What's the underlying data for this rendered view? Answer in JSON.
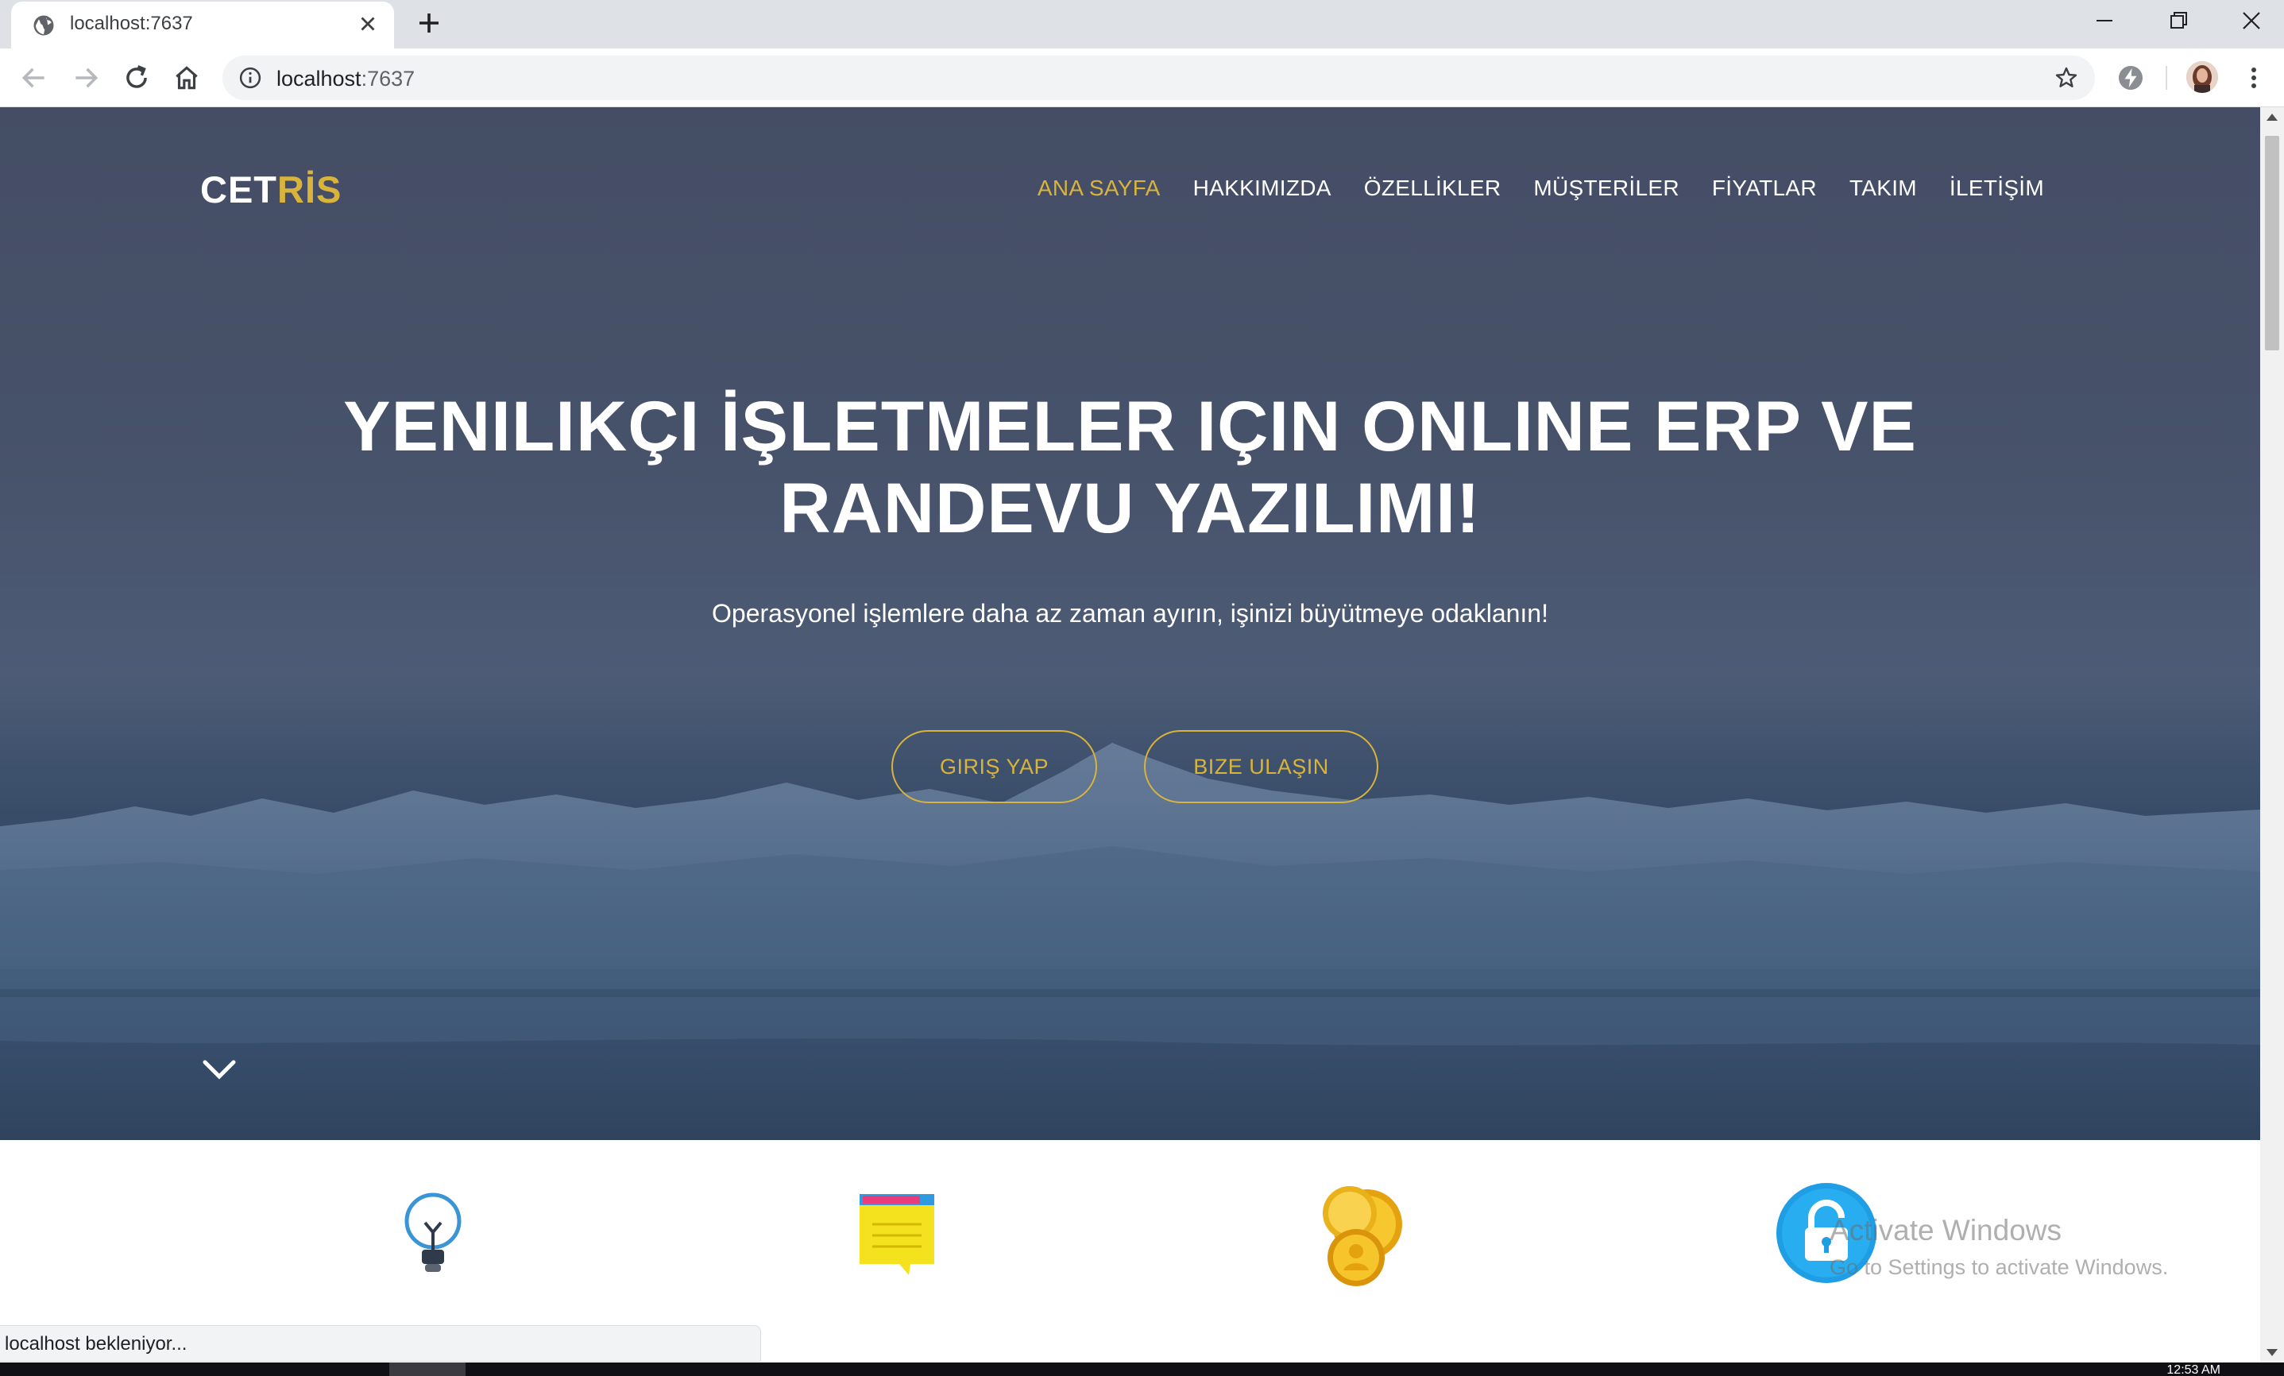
{
  "browser": {
    "tab": {
      "title": "localhost:7637"
    },
    "address": {
      "host": "localhost",
      "port": ":7637"
    }
  },
  "site": {
    "brand": {
      "part1": "CET",
      "part2": "RİS"
    },
    "nav": [
      {
        "label": "ANA SAYFA",
        "active": true
      },
      {
        "label": "HAKKIMIZDA"
      },
      {
        "label": "ÖZELLİKLER"
      },
      {
        "label": "MÜŞTERİLER"
      },
      {
        "label": "FİYATLAR"
      },
      {
        "label": "TAKIM"
      },
      {
        "label": "İLETİŞİM"
      }
    ],
    "hero": {
      "title_line1": "YENILIKÇI İŞLETMELER IÇIN ONLINE ERP VE",
      "title_line2": "RANDEVU YAZILIMI!",
      "subtitle": "Operasyonel işlemlere daha az zaman ayırın, işinizi büyütmeye odaklanın!",
      "login_button": "GIRIŞ YAP",
      "contact_button": "BIZE ULAŞIN"
    },
    "features": [
      {
        "icon": "lightbulb-icon"
      },
      {
        "icon": "sticky-note-icon"
      },
      {
        "icon": "coins-icon"
      },
      {
        "icon": "lock-icon"
      }
    ]
  },
  "colors": {
    "accent": "#d9b43c",
    "hero_bg": "#4a556e"
  },
  "status_bar": {
    "text": "localhost bekleniyor..."
  },
  "watermark": {
    "line1": "Activate Windows",
    "line2": "Go to Settings to activate Windows."
  },
  "taskbar": {
    "clock": "12:53 AM"
  }
}
